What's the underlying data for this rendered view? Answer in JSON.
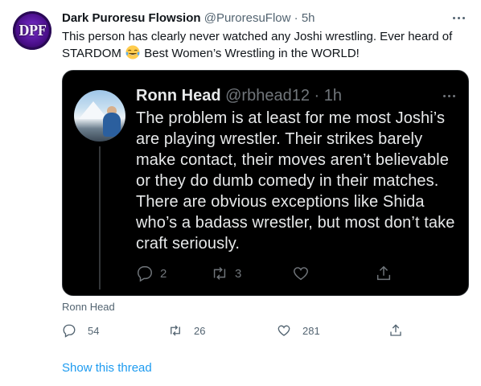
{
  "tweet": {
    "avatar_text": "DPF",
    "display_name": "Dark Puroresu Flowsion",
    "handle": "@PuroresuFlow",
    "separator": "·",
    "time": "5h",
    "text_before_emoji": "This person has clearly never watched any Joshi wrestling. Ever heard of STARDOM",
    "emoji": "face-with-tears-of-joy",
    "text_after_emoji": "Best Women’s Wrestling in the WORLD!",
    "attribution": "Ronn Head",
    "actions": {
      "reply_count": "54",
      "retweet_count": "26",
      "like_count": "281"
    },
    "show_thread": "Show this thread"
  },
  "quoted": {
    "display_name": "Ronn Head",
    "handle": "@rbhead12",
    "separator": "·",
    "time": "1h",
    "text": "The problem is at least for me most Joshi’s are playing wrestler.  Their strikes barely make contact, their moves aren’t believable or they do dumb comedy in their matches.  There are obvious exceptions like Shida who’s a badass wrestler, but most don’t take craft seriously.",
    "actions": {
      "reply_count": "2",
      "retweet_count": "3"
    }
  },
  "colors": {
    "link": "#1d9bf0",
    "secondary_text": "#536471",
    "quote_bg": "#000000"
  }
}
